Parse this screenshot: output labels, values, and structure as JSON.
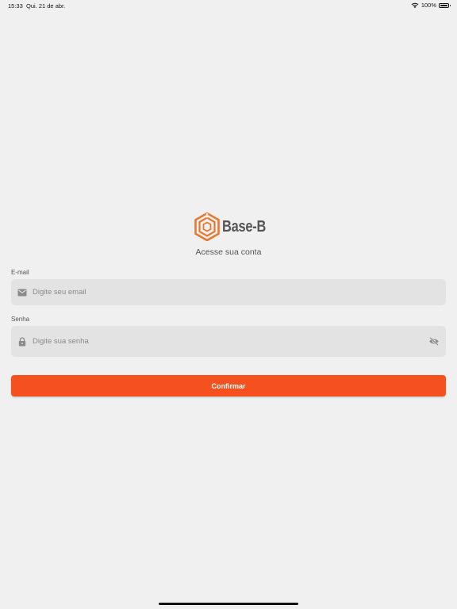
{
  "status_bar": {
    "time": "15:33",
    "date": "Qui. 21 de abr.",
    "battery": "100%",
    "icons": [
      "wifi-icon",
      "battery-icon"
    ]
  },
  "logo": {
    "text": "Base-B",
    "mark_icon": "hexagon-logo-icon",
    "colors": {
      "mark": "#e8782f",
      "text": "#555555"
    }
  },
  "subtitle": "Acesse sua conta",
  "form": {
    "email": {
      "label": "E-mail",
      "placeholder": "Digite seu email",
      "value": "",
      "icon": "mail-icon"
    },
    "password": {
      "label": "Senha",
      "placeholder": "Digite sua senha",
      "value": "",
      "icon": "lock-icon",
      "toggle_icon": "eye-off-icon"
    },
    "confirm_label": "Confirmar"
  },
  "colors": {
    "background": "#f0f0f0",
    "field_background": "#e3e3e3",
    "accent": "#f4511e"
  }
}
